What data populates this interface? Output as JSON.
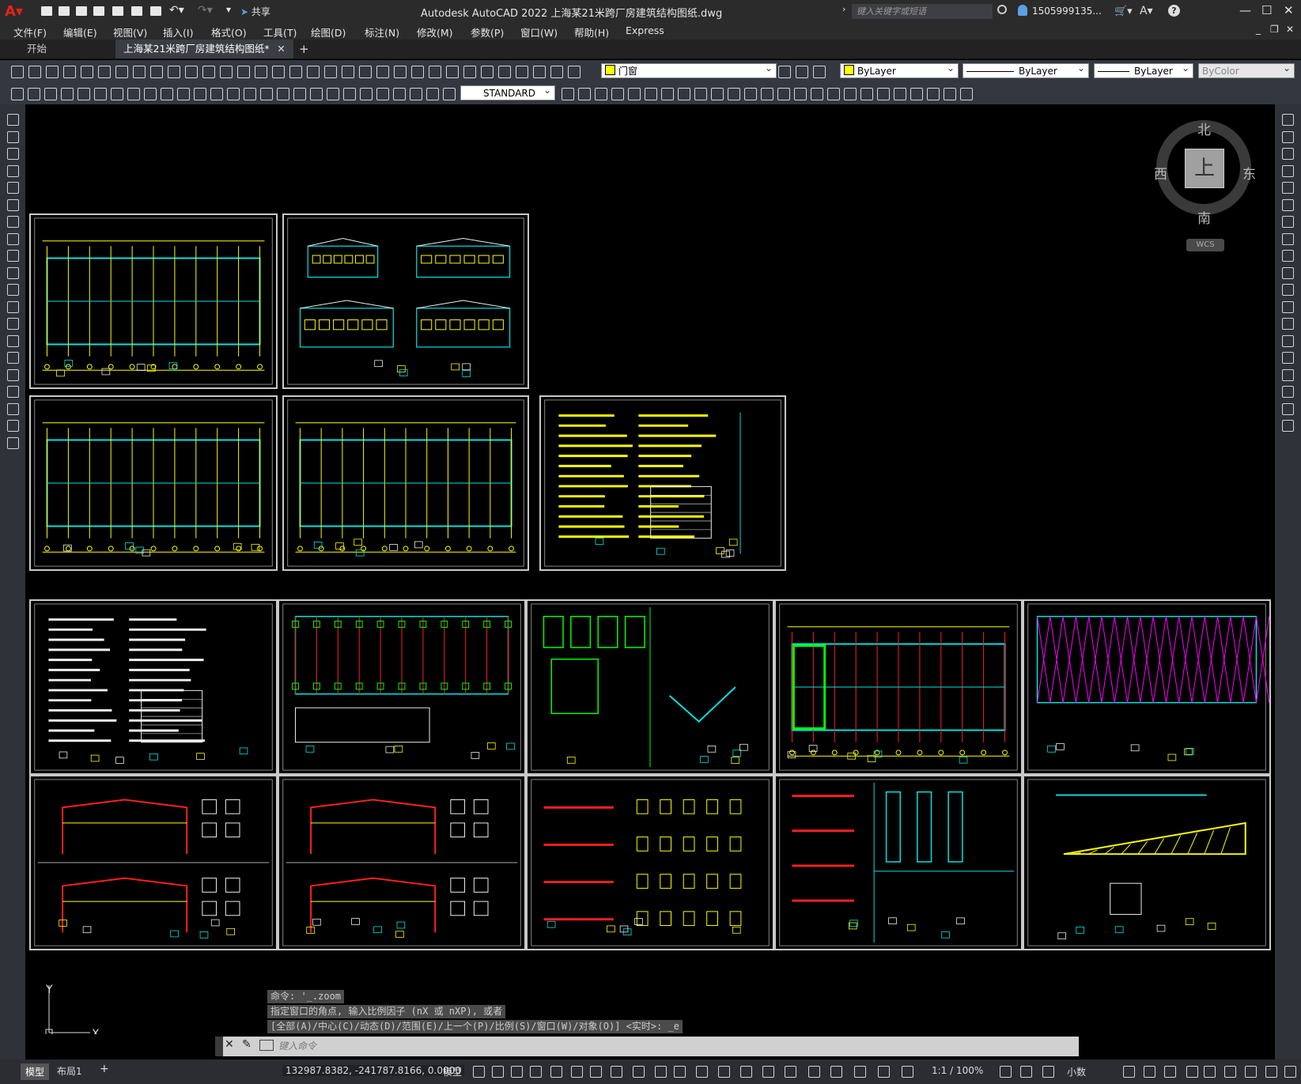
{
  "window": {
    "app_title": "Autodesk AutoCAD 2022    上海某21米跨厂房建筑结构图纸.dwg",
    "share_label": "共享",
    "search_placeholder": "键入关键字或短语",
    "user": "1505999135...",
    "controls": [
      "—",
      "☐",
      "✕"
    ]
  },
  "menu": [
    "文件(F)",
    "编辑(E)",
    "视图(V)",
    "插入(I)",
    "格式(O)",
    "工具(T)",
    "绘图(D)",
    "标注(N)",
    "修改(M)",
    "参数(P)",
    "窗口(W)",
    "帮助(H)",
    "Express"
  ],
  "tabs": {
    "start": "开始",
    "document": "上海某21米跨厂房建筑结构图纸*",
    "close": "✕",
    "add": "+"
  },
  "toolbar": {
    "layer_name": "门窗",
    "color": "ByLayer",
    "linetype": "ByLayer",
    "lineweight": "ByLayer",
    "plotstyle": "ByColor",
    "textstyle": "STANDARD"
  },
  "viewcube": {
    "top": "上",
    "north": "北",
    "south": "南",
    "east": "东",
    "west": "西",
    "wcs": "WCS"
  },
  "ucs": {
    "y": "Y",
    "x": "X"
  },
  "command": {
    "history": [
      "命令: '_.zoom",
      "指定窗口的角点, 输入比例因子 (nX 或 nXP), 或者",
      "[全部(A)/中心(C)/动态(D)/范围(E)/上一个(P)/比例(S)/窗口(W)/对象(O)] <实时>: _e"
    ],
    "placeholder": "键入命令"
  },
  "status": {
    "model_tab": "模型",
    "layout_tab": "布局1",
    "add_tab": "+",
    "coords": "132987.8382, -241787.8166, 0.0000",
    "space": "模型",
    "scale": "1:1 / 100%",
    "units": "小数"
  },
  "colors": {
    "cyan": "#00e5e5",
    "yellow": "#ffff00",
    "green": "#00ff00",
    "red": "#ff2020",
    "magenta": "#ff00ff",
    "white": "#f0f0f0"
  }
}
